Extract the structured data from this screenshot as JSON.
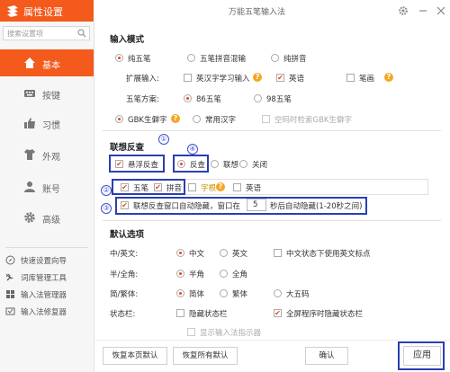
{
  "app": {
    "title": "属性设置",
    "window_title": "万能五笔输入法",
    "accent_color": "#f35a1c",
    "annotation_color": "#2a3fb3"
  },
  "search": {
    "placeholder": "搜索设置项"
  },
  "sidebar": {
    "items": [
      {
        "label": "基本",
        "icon": "home-icon",
        "active": true
      },
      {
        "label": "按键",
        "icon": "keyboard-icon",
        "active": false
      },
      {
        "label": "习惯",
        "icon": "thumb-icon",
        "active": false
      },
      {
        "label": "外观",
        "icon": "shirt-icon",
        "active": false
      },
      {
        "label": "账号",
        "icon": "person-icon",
        "active": false
      },
      {
        "label": "高级",
        "icon": "gear-icon",
        "active": false
      }
    ],
    "tools": [
      {
        "label": "快速设置向导",
        "icon": "compass-icon"
      },
      {
        "label": "词库管理工具",
        "icon": "wrench-icon"
      },
      {
        "label": "输入法管理器",
        "icon": "grid-icon"
      },
      {
        "label": "输入法修复器",
        "icon": "repair-icon"
      }
    ]
  },
  "input_mode": {
    "title": "输入模式",
    "modes": [
      "纯五笔",
      "五笔拼音混输",
      "纯拼音"
    ],
    "mode_selected": 0,
    "ext_label": "扩展输入:",
    "ext_options": [
      {
        "label": "英汉字学习输入",
        "checked": false,
        "help": true
      },
      {
        "label": "英语",
        "checked": true,
        "help": false
      },
      {
        "label": "笔画",
        "checked": false,
        "help": true
      }
    ],
    "scheme_label": "五笔方案:",
    "schemes": [
      "86五笔",
      "98五笔"
    ],
    "scheme_selected": 0,
    "charsets": [
      "GBK生僻字",
      "常用汉字"
    ],
    "charset_selected": 0,
    "space_gbk": "空码时检索GBK生僻字"
  },
  "lianxiang": {
    "title": "联想反查",
    "float_label": "悬浮反查",
    "modes": [
      "反查",
      "联想",
      "关闭"
    ],
    "mode_selected": 0,
    "sub_options": [
      {
        "label": "五笔",
        "checked": true
      },
      {
        "label": "拼音",
        "checked": true
      },
      {
        "label": "字根",
        "checked": false,
        "help": true
      },
      {
        "label": "英语",
        "checked": false
      }
    ],
    "autohide_prefix": "联想反查窗口自动隐藏，窗口在",
    "autohide_value": "5",
    "autohide_suffix": "秒后自动隐藏(1-20秒之间)"
  },
  "annotations": [
    "①",
    "②",
    "③",
    "④"
  ],
  "defaults": {
    "title": "默认选项",
    "cn_en_label": "中/英文:",
    "cn_en": [
      "中文",
      "英文"
    ],
    "cn_en_selected": 0,
    "cn_en_extra": "中文状态下使用英文标点",
    "width_label": "半/全角:",
    "width": [
      "半角",
      "全角"
    ],
    "width_selected": 0,
    "script_label": "简/繁体:",
    "script": [
      "简体",
      "繁体",
      "大五码"
    ],
    "script_selected": 0,
    "status_label": "状态栏:",
    "status_hide": "隐藏状态栏",
    "status_fullscreen": "全屏程序时隐藏状态栏",
    "status_indicator": "显示输入法指示器"
  },
  "buttons": {
    "restore_page": "恢复本页默认",
    "restore_all": "恢复所有默认",
    "ok": "确认",
    "apply": "应用"
  }
}
